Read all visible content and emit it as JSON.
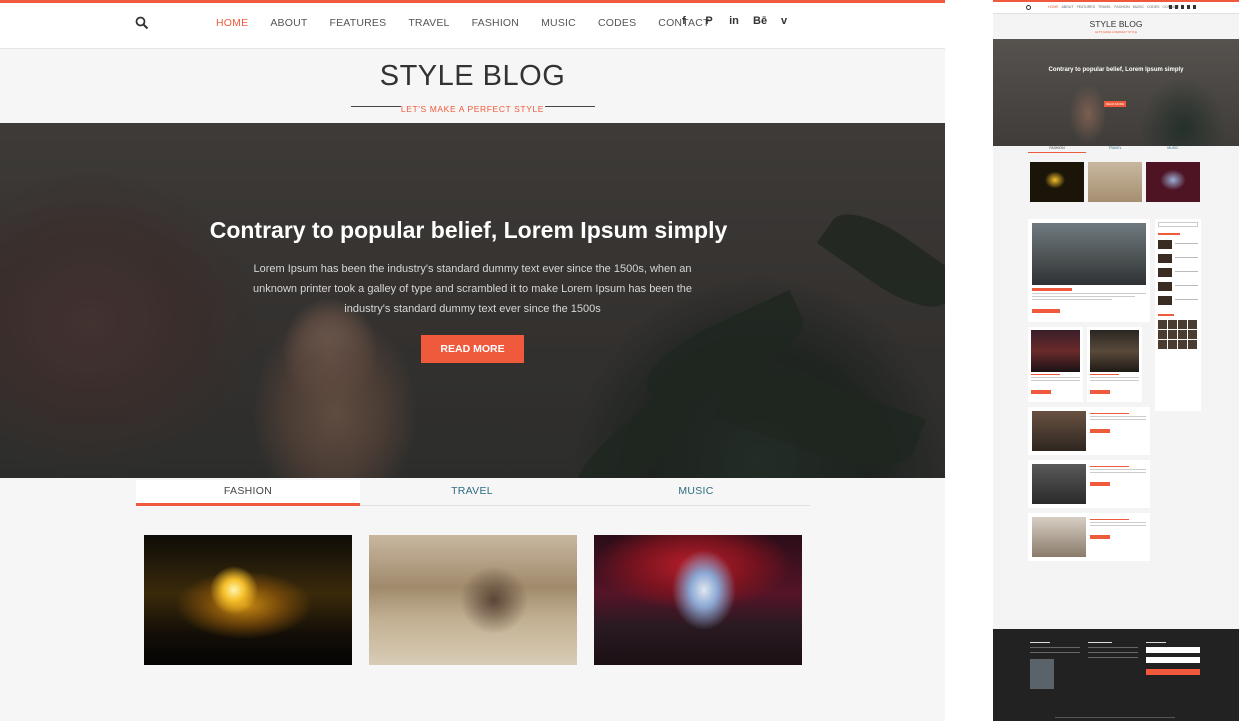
{
  "nav": {
    "items": [
      {
        "label": "HOME",
        "active": true
      },
      {
        "label": "ABOUT",
        "active": false
      },
      {
        "label": "FEATURES",
        "active": false
      },
      {
        "label": "TRAVEL",
        "active": false
      },
      {
        "label": "FASHION",
        "active": false
      },
      {
        "label": "MUSIC",
        "active": false
      },
      {
        "label": "CODES",
        "active": false
      },
      {
        "label": "CONTACT",
        "active": false
      }
    ],
    "social": [
      {
        "icon": "facebook-icon",
        "glyph": "f"
      },
      {
        "icon": "pinterest-icon",
        "glyph": "P"
      },
      {
        "icon": "linkedin-icon",
        "glyph": "in"
      },
      {
        "icon": "behance-icon",
        "glyph": "Bē"
      },
      {
        "icon": "vimeo-icon",
        "glyph": "v"
      }
    ]
  },
  "brand": {
    "title": "STYLE BLOG",
    "tagline": "LET'S MAKE A PERFECT STYLE"
  },
  "hero": {
    "headline": "Contrary to popular belief, Lorem Ipsum simply",
    "body": "Lorem Ipsum has been the industry's standard dummy text ever since the 1500s, when an unknown printer took a galley of type and scrambled it to make Lorem Ipsum has been the industry's standard dummy text ever since the 1500s",
    "button": "READ MORE"
  },
  "tabs": [
    {
      "label": "FASHION",
      "active": true
    },
    {
      "label": "TRAVEL",
      "active": false
    },
    {
      "label": "MUSIC",
      "active": false
    }
  ],
  "colors": {
    "accent": "#f05a3c",
    "tab_text": "#2d6c80"
  }
}
